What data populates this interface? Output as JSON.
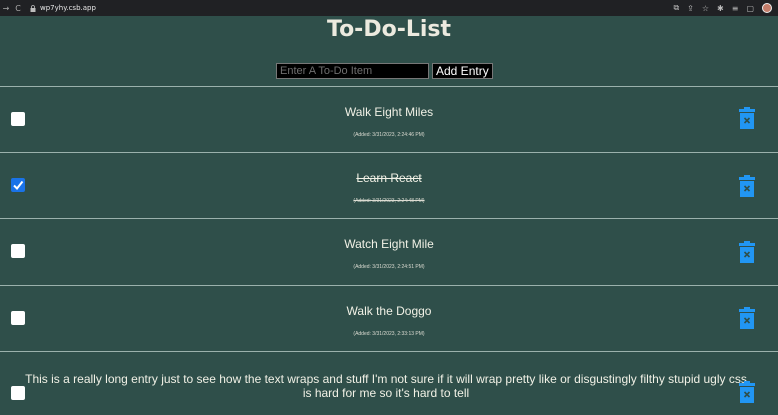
{
  "browser": {
    "url": "wp7yhy.csb.app"
  },
  "app": {
    "title": "To-Do-List",
    "entry_placeholder": "Enter A To-Do Item",
    "add_label": "Add Entry"
  },
  "todos": [
    {
      "text": "Walk Eight Miles",
      "added": "(Added: 3/31/2023, 2:24:46 PM)",
      "done": false
    },
    {
      "text": "Learn React",
      "added": "(Added: 3/31/2023, 2:24:48 PM)",
      "done": true
    },
    {
      "text": "Watch Eight Mile",
      "added": "(Added: 3/31/2023, 2:24:51 PM)",
      "done": false
    },
    {
      "text": "Walk the Doggo",
      "added": "(Added: 3/31/2023, 2:33:13 PM)",
      "done": false
    },
    {
      "text": "This is a really long entry just to see how the text wraps and stuff I'm not sure if it will wrap pretty like or disgustingly filthy stupid ugly css is hard for me so it's hard to tell",
      "done": false
    }
  ],
  "colors": {
    "background": "#2f4f4a",
    "checkbox_checked": "#1a73e8",
    "trash_icon": "#2196f3"
  },
  "icons": {
    "back": "arrow-left-icon",
    "reload": "reload-icon",
    "lock": "lock-icon",
    "delete": "trash-icon"
  }
}
